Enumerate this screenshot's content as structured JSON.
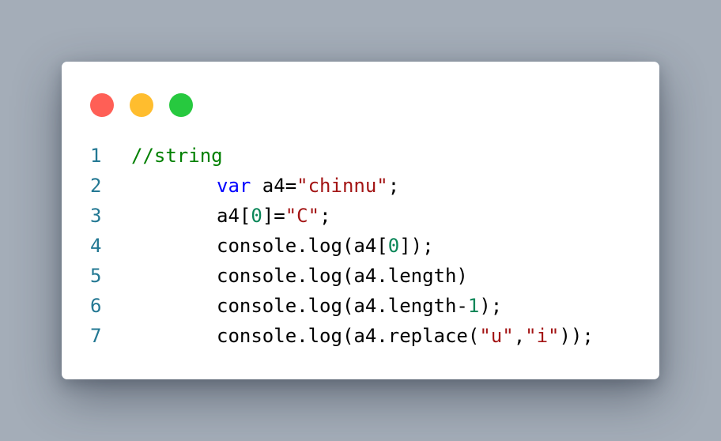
{
  "window": {
    "controls": [
      {
        "name": "close",
        "color": "#ff5f56"
      },
      {
        "name": "minimize",
        "color": "#ffbd2e"
      },
      {
        "name": "maximize",
        "color": "#27c93f"
      }
    ]
  },
  "code": {
    "lines": [
      {
        "number": "1",
        "tokens": [
          {
            "type": "comment",
            "text": "//string"
          }
        ]
      },
      {
        "number": "2",
        "tokens": [
          {
            "type": "keyword",
            "text": "var"
          },
          {
            "type": "plain",
            "text": " a4="
          },
          {
            "type": "string",
            "text": "\"chinnu\""
          },
          {
            "type": "plain",
            "text": ";"
          }
        ]
      },
      {
        "number": "3",
        "tokens": [
          {
            "type": "plain",
            "text": "a4["
          },
          {
            "type": "number",
            "text": "0"
          },
          {
            "type": "plain",
            "text": "]="
          },
          {
            "type": "string",
            "text": "\"C\""
          },
          {
            "type": "plain",
            "text": ";"
          }
        ]
      },
      {
        "number": "4",
        "tokens": [
          {
            "type": "plain",
            "text": "console.log(a4["
          },
          {
            "type": "number",
            "text": "0"
          },
          {
            "type": "plain",
            "text": "]);"
          }
        ]
      },
      {
        "number": "5",
        "tokens": [
          {
            "type": "plain",
            "text": "console.log(a4.length)"
          }
        ]
      },
      {
        "number": "6",
        "tokens": [
          {
            "type": "plain",
            "text": "console.log(a4.length-"
          },
          {
            "type": "number",
            "text": "1"
          },
          {
            "type": "plain",
            "text": ");"
          }
        ]
      },
      {
        "number": "7",
        "tokens": [
          {
            "type": "plain",
            "text": "console.log(a4.replace("
          },
          {
            "type": "string",
            "text": "\"u\""
          },
          {
            "type": "plain",
            "text": ","
          },
          {
            "type": "string",
            "text": "\"i\""
          },
          {
            "type": "plain",
            "text": "));"
          }
        ]
      }
    ]
  }
}
